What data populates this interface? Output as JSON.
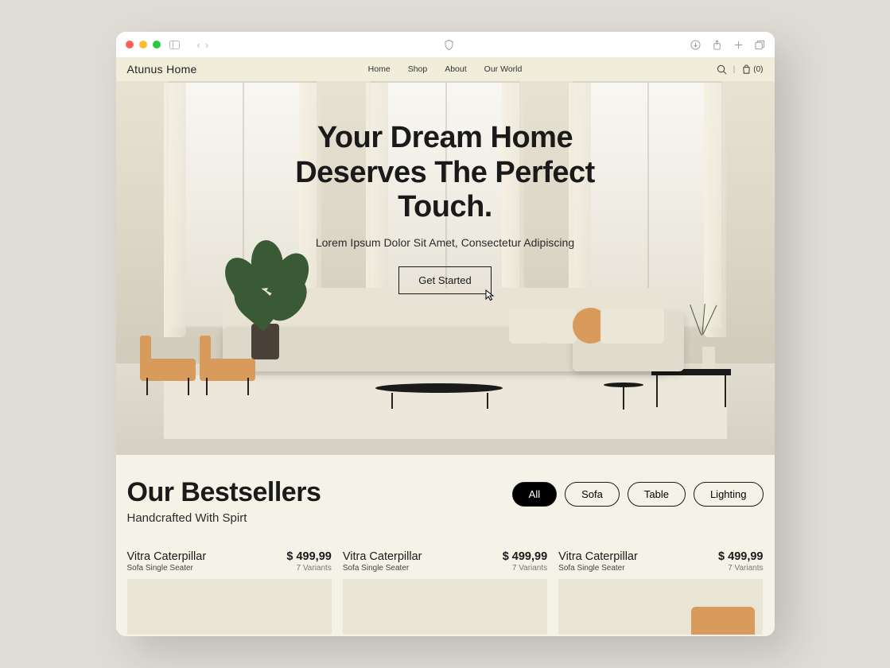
{
  "brand": "Atunus Home",
  "nav": {
    "home": "Home",
    "shop": "Shop",
    "about": "About",
    "our_world": "Our World"
  },
  "header": {
    "cart_count": "(0)"
  },
  "hero": {
    "title_line1": "Your Dream Home",
    "title_line2": "Deserves The Perfect",
    "title_line3": "Touch.",
    "subtitle": "Lorem Ipsum Dolor Sit Amet, Consectetur Adipiscing",
    "cta": "Get Started"
  },
  "bestsellers": {
    "title": "Our Bestsellers",
    "subtitle": "Handcrafted With Spirt",
    "filters": {
      "all": "All",
      "sofa": "Sofa",
      "table": "Table",
      "lighting": "Lighting"
    }
  },
  "products": [
    {
      "name": "Vitra Caterpillar",
      "category": "Sofa Single Seater",
      "price": "$ 499,99",
      "variants": "7 Variants"
    },
    {
      "name": "Vitra Caterpillar",
      "category": "Sofa Single Seater",
      "price": "$ 499,99",
      "variants": "7 Variants"
    },
    {
      "name": "Vitra Caterpillar",
      "category": "Sofa Single Seater",
      "price": "$ 499,99",
      "variants": "7 Variants"
    }
  ]
}
